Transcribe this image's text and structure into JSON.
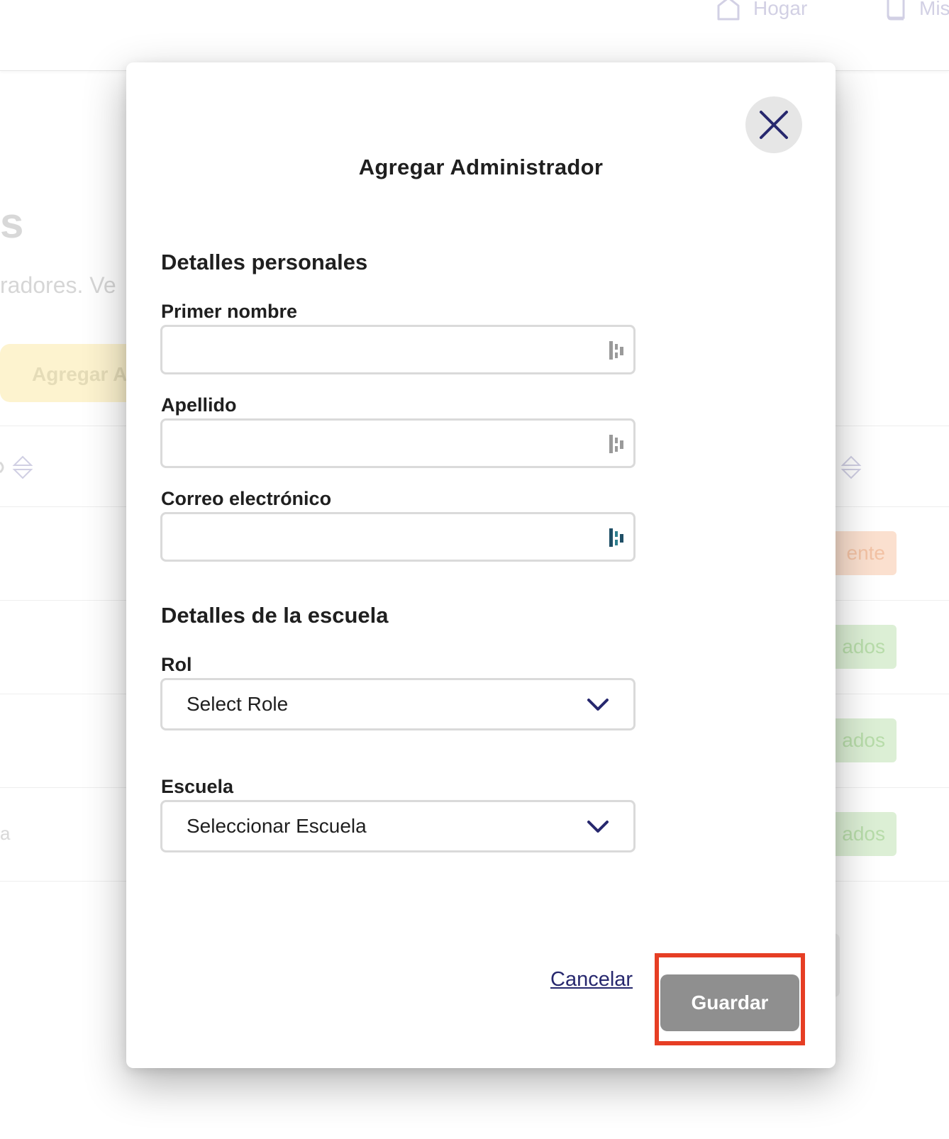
{
  "background": {
    "nav": {
      "home_label": "Hogar",
      "mis_label": "Mis"
    },
    "page_title_fragment": "s",
    "page_subtitle_fragment": "radores. Ve",
    "add_button_fragment": "Agregar A",
    "row_fragment": "a",
    "badges": [
      {
        "text": "ente",
        "color": "#fbe0cf"
      },
      {
        "text": "ados",
        "color": "#dcefd5"
      },
      {
        "text": "ados",
        "color": "#dcefd5"
      },
      {
        "text": "ados",
        "color": "#dcefd5"
      }
    ]
  },
  "modal": {
    "title": "Agregar Administrador",
    "close_icon": "close-x-icon",
    "personal_section": {
      "heading": "Detalles personales",
      "first_name": {
        "label": "Primer nombre",
        "value": "",
        "placeholder": ""
      },
      "last_name": {
        "label": "Apellido",
        "value": "",
        "placeholder": ""
      },
      "email": {
        "label": "Correo electrónico",
        "value": "",
        "placeholder": ""
      }
    },
    "school_section": {
      "heading": "Detalles de la escuela",
      "role": {
        "label": "Rol",
        "selected": "Select Role"
      },
      "school": {
        "label": "Escuela",
        "selected": "Seleccionar Escuela"
      }
    },
    "actions": {
      "cancel_label": "Cancelar",
      "save_label": "Guardar"
    }
  },
  "colors": {
    "accent_navy": "#27286e",
    "save_disabled": "#8f8f8f",
    "highlight_red": "#e63e24"
  }
}
